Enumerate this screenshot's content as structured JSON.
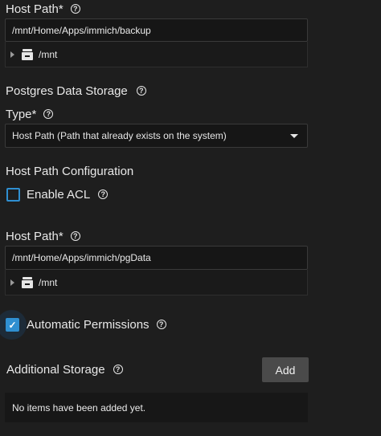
{
  "host_path_1": {
    "label": "Host Path",
    "required_mark": "*",
    "value": "/mnt/Home/Apps/immich/backup",
    "tree_root": "/mnt"
  },
  "postgres": {
    "title": "Postgres Data Storage",
    "type_label": "Type",
    "required_mark": "*",
    "type_value": "Host Path (Path that already exists on the system)"
  },
  "host_path_config": {
    "title": "Host Path Configuration",
    "enable_acl_label": "Enable ACL",
    "enable_acl_checked": false
  },
  "host_path_2": {
    "label": "Host Path",
    "required_mark": "*",
    "value": "/mnt/Home/Apps/immich/pgData",
    "tree_root": "/mnt"
  },
  "automatic_permissions": {
    "label": "Automatic Permissions",
    "checked": true
  },
  "additional_storage": {
    "title": "Additional Storage",
    "add_label": "Add",
    "empty_text": "No items have been added yet."
  },
  "icons": {
    "help": "?",
    "check": "✓"
  },
  "colors": {
    "background": "#1e1e1e",
    "accent": "#2f8fd1",
    "button": "#4a4a4a"
  }
}
